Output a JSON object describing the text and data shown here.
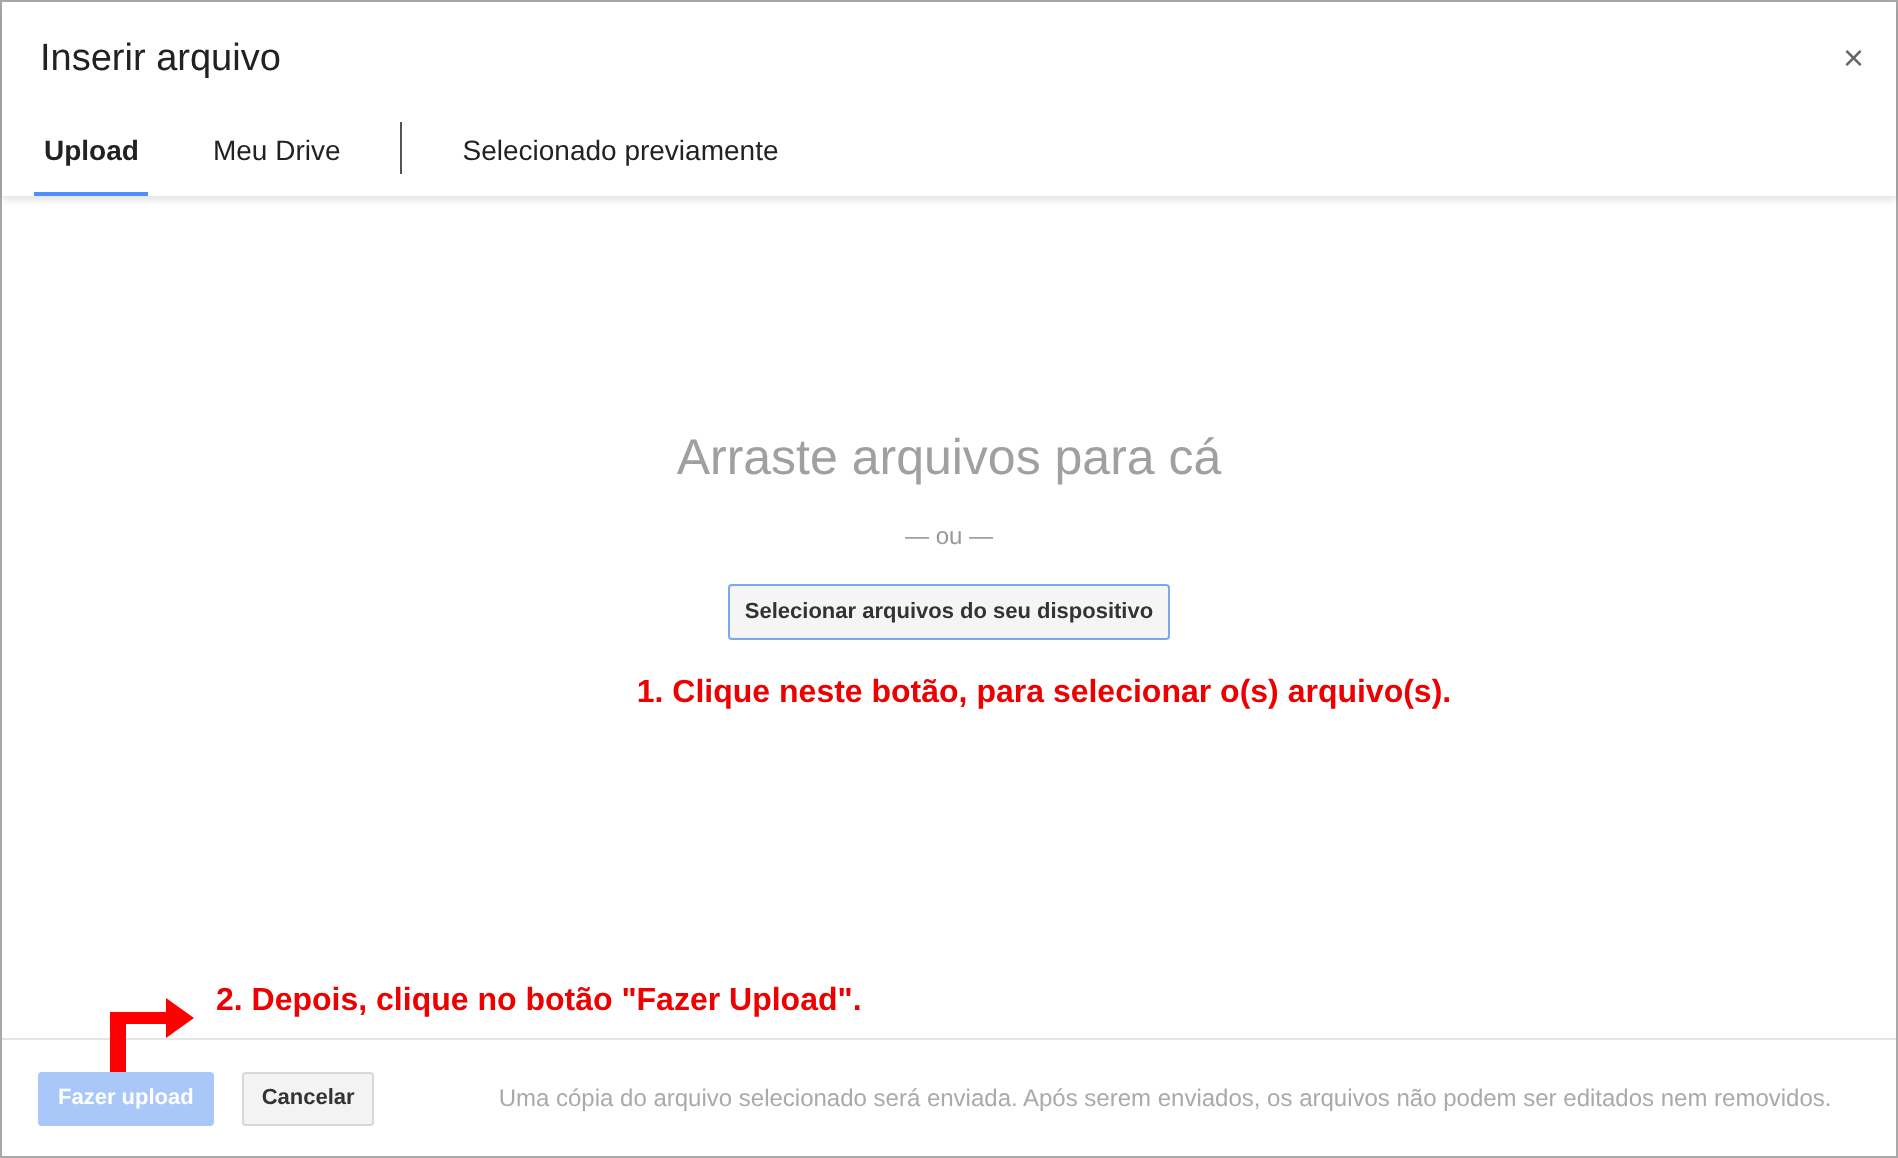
{
  "dialog": {
    "title": "Inserir arquivo",
    "close": "×"
  },
  "tabs": [
    {
      "label": "Upload",
      "selected": true
    },
    {
      "label": "Meu Drive",
      "selected": false
    },
    {
      "label": "Selecionado previamente",
      "selected": false
    }
  ],
  "drop_area": {
    "heading": "Arraste arquivos para cá",
    "separator": "— ou —",
    "select_button": "Selecionar arquivos do seu dispositivo"
  },
  "annotations": [
    "1. Clique neste botão, para selecionar o(s) arquivo(s).",
    "2. Depois, clique no botão \"Fazer Upload\"."
  ],
  "footer": {
    "buttons": [
      {
        "label": "Fazer upload",
        "disabled": true
      },
      {
        "label": "Cancelar",
        "disabled": false
      }
    ],
    "note": "Uma cópia do arquivo selecionado será enviada. Após serem enviados, os arquivos não podem ser editados nem removidos."
  }
}
